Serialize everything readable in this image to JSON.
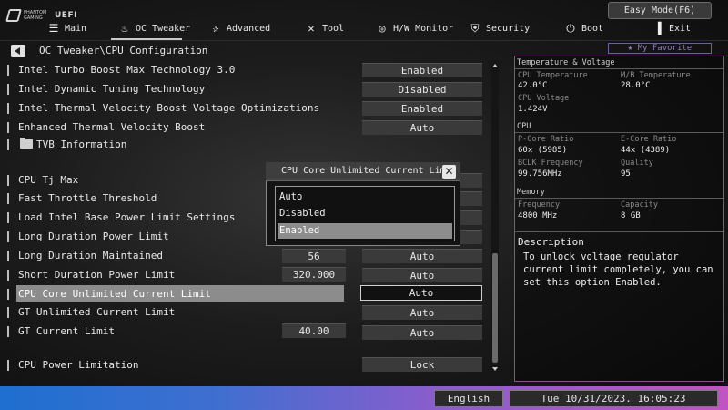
{
  "brand": {
    "logo_small": "PHANTOM GAMING",
    "logo_uefi": "UEFI"
  },
  "easy_mode": "Easy Mode(F6)",
  "menu": [
    {
      "label": "Main",
      "icon": "list-icon"
    },
    {
      "label": "OC Tweaker",
      "icon": "flame-icon"
    },
    {
      "label": "Advanced",
      "icon": "star-icon"
    },
    {
      "label": "Tool",
      "icon": "tools-icon"
    },
    {
      "label": "H/W Monitor",
      "icon": "monitor-gauge-icon"
    },
    {
      "label": "Security",
      "icon": "shield-icon"
    },
    {
      "label": "Boot",
      "icon": "power-icon"
    },
    {
      "label": "Exit",
      "icon": "exit-door-icon"
    }
  ],
  "breadcrumb": "OC Tweaker\\CPU Configuration",
  "favorite": "★ My Favorite",
  "settings": [
    {
      "label": "Intel Turbo Boost Max Technology 3.0",
      "value": "Enabled"
    },
    {
      "label": "Intel Dynamic Tuning Technology",
      "value": "Disabled"
    },
    {
      "label": "Intel Thermal Velocity Boost Voltage Optimizations",
      "value": "Enabled"
    },
    {
      "label": "Enhanced Thermal Velocity Boost",
      "value": "Auto"
    },
    {
      "label": "TVB Information"
    },
    {
      "label": "CPU Tj Max"
    },
    {
      "label": "Fast Throttle Threshold"
    },
    {
      "label": "Load Intel Base Power Limit Settings"
    },
    {
      "label": "Long Duration Power Limit"
    },
    {
      "label": "Long Duration Maintained",
      "num": "56",
      "value": "Auto"
    },
    {
      "label": "Short Duration Power Limit",
      "num": "320.000",
      "value": "Auto"
    },
    {
      "label": "CPU Core Unlimited Current Limit",
      "value": "Auto"
    },
    {
      "label": "GT Unlimited Current Limit",
      "value": "Auto"
    },
    {
      "label": "GT Current Limit",
      "num": "40.00",
      "value": "Auto"
    },
    {
      "label": "CPU Power Limitation",
      "value": "Lock"
    }
  ],
  "popup": {
    "title": "CPU Core Unlimited Current Limit",
    "close": "✕",
    "options": [
      "Auto",
      "Disabled",
      "Enabled"
    ],
    "selected": "Enabled"
  },
  "monitor": {
    "temp_head": "Temperature & Voltage",
    "cpu_temp_label": "CPU Temperature",
    "cpu_temp": "42.0°C",
    "mb_temp_label": "M/B Temperature",
    "mb_temp": "28.0°C",
    "cpu_volt_label": "CPU Voltage",
    "cpu_volt": "1.424V",
    "cpu_head": "CPU",
    "pcore_label": "P-Core Ratio",
    "pcore": "60x (5985)",
    "ecore_label": "E-Core Ratio",
    "ecore": "44x (4389)",
    "bclk_label": "BCLK Frequency",
    "bclk": "99.756MHz",
    "quality_label": "Quality",
    "quality": "95",
    "mem_head": "Memory",
    "freq_label": "Frequency",
    "freq": "4800 MHz",
    "cap_label": "Capacity",
    "cap": "8 GB"
  },
  "description": {
    "title": "Description",
    "text": "To unlock voltage regulator current limit completely, you can set this option Enabled."
  },
  "footer": {
    "language": "English",
    "datetime": "Tue 10/31/2023. 16:05:23"
  },
  "colors": {
    "panel_border": "#a53fa3",
    "bar_start": "#1e6fd0",
    "bar_end": "#c253c3"
  }
}
